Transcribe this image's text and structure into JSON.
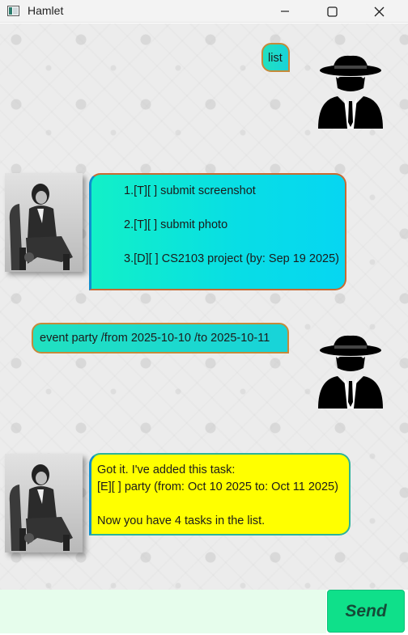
{
  "window": {
    "title": "Hamlet",
    "controls": [
      "minimize",
      "maximize",
      "close"
    ]
  },
  "messages": [
    {
      "sender": "user",
      "lines": [
        "list"
      ]
    },
    {
      "sender": "bot",
      "style": "cyan",
      "lines": [
        "1.[T][ ] submit screenshot",
        "",
        "2.[T][ ] submit photo",
        "",
        "3.[D][ ] CS2103 project (by: Sep 19 2025)"
      ]
    },
    {
      "sender": "user",
      "lines": [
        "event party /from 2025-10-10 /to 2025-10-11"
      ]
    },
    {
      "sender": "bot",
      "style": "yellow",
      "lines": [
        "Got it. I've added this task:",
        "[E][ ] party (from: Oct 10 2025 to: Oct 11 2025)",
        "",
        "Now you have 4 tasks in the list."
      ]
    }
  ],
  "input": {
    "value": "",
    "placeholder": ""
  },
  "send_button": {
    "label": "Send"
  },
  "colors": {
    "user_bubble": "#21e1c0",
    "bot_bubble_cyan": "#06d6f2",
    "bot_bubble_yellow": "#ffff00",
    "send_button": "#0fe08a",
    "input_background": "#e6fdec"
  }
}
